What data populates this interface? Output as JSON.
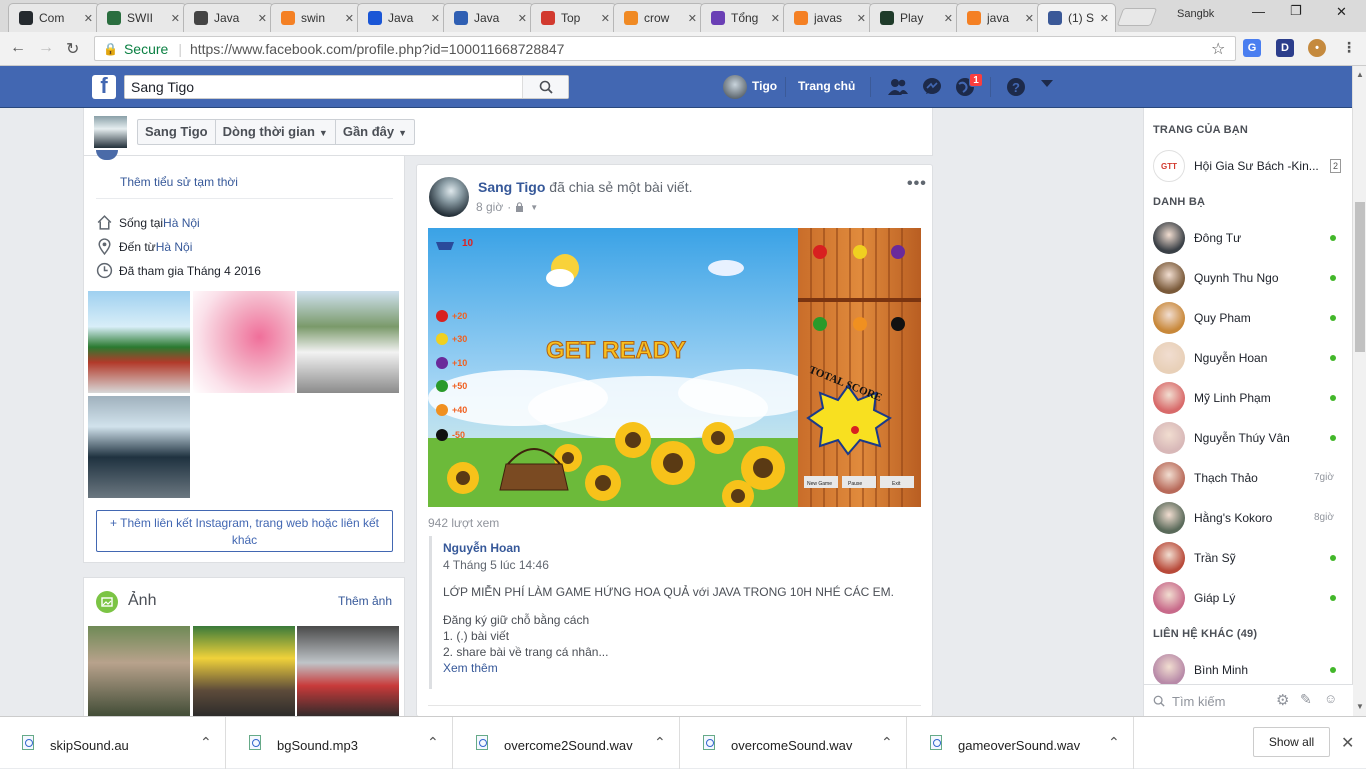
{
  "browser": {
    "tabs": [
      {
        "label": "Com",
        "icon": "github-icon",
        "color": "#24292e"
      },
      {
        "label": "SWII",
        "icon": "diamond-icon",
        "color": "#2a6e3f"
      },
      {
        "label": "Java",
        "icon": "T-icon",
        "color": "#444444"
      },
      {
        "label": "swin",
        "icon": "stackoverflow-icon",
        "color": "#f48024"
      },
      {
        "label": "Java",
        "icon": "d-icon",
        "color": "#1a56d6"
      },
      {
        "label": "Java",
        "icon": "A-icon",
        "color": "#2f5fb3"
      },
      {
        "label": "Top",
        "icon": "t-red-icon",
        "color": "#d23a2f"
      },
      {
        "label": "crow",
        "icon": "rss-icon",
        "color": "#f08a24"
      },
      {
        "label": "Tổng",
        "icon": "at-icon",
        "color": "#6a3fb5"
      },
      {
        "label": "javas",
        "icon": "stackoverflow-icon",
        "color": "#f48024"
      },
      {
        "label": "Play",
        "icon": "terminal-icon",
        "color": "#1f3b2a"
      },
      {
        "label": "java",
        "icon": "stackoverflow-icon",
        "color": "#f48024"
      },
      {
        "label": "(1) S",
        "icon": "facebook-icon",
        "color": "#3b5998"
      }
    ],
    "profile_name": "Sangbk",
    "secure_label": "Secure",
    "url": "https://www.facebook.com/profile.php?id=100011668728847"
  },
  "fb": {
    "search_value": "Sang Tigo",
    "user_name": "Tigo",
    "home_label": "Trang chủ",
    "notif_count": "1",
    "accent": "#4267b2"
  },
  "profile_header": {
    "name_btn": "Sang Tigo",
    "timeline_btn": "Dòng thời gian",
    "recent_btn": "Gần đây"
  },
  "intro": {
    "temp_story": "Thêm tiểu sử tạm thời",
    "lives_prefix": "Sống tại ",
    "lives_city": "Hà Nội",
    "from_prefix": "Đến từ ",
    "from_city": "Hà Nội",
    "joined": "Đã tham gia Tháng 4 2016",
    "insta_link": "+ Thêm liên kết Instagram, trang web hoặc liên kết khác"
  },
  "photos": {
    "title": "Ảnh",
    "more": "Thêm ảnh"
  },
  "post": {
    "author": "Sang Tigo",
    "action": " đã chia sẻ một bài viết.",
    "time": "8 giờ",
    "views": "942 lượt xem",
    "game": {
      "count": "10",
      "get_ready": "GET READY",
      "total_score": "TOTAL SCORE",
      "scores": [
        "+20",
        "+30",
        "+10",
        "+50",
        "+40",
        "-50"
      ],
      "buttons": [
        "New Game",
        "Pause",
        "Exit"
      ]
    },
    "shared": {
      "name": "Nguyễn Hoan",
      "date": "4 Tháng 5 lúc 14:46",
      "title": "LỚP MIỄN PHÍ LÀM GAME HỨNG HOA QUẢ với JAVA TRONG 10H NHÉ CÁC EM.",
      "line1": "Đăng ký giữ chỗ bằng cách",
      "line2": "1. (.) bài viết",
      "line3": "2. share bài về trang cá nhân...",
      "more": "Xem thêm"
    }
  },
  "sidebar": {
    "pages_header": "TRANG CỦA BẠN",
    "page_name": "Hội Gia Sư Bách -Kin...",
    "page_badge": "2",
    "contacts_header": "DANH BẠ",
    "contacts": [
      {
        "name": "Đông Tư",
        "status": "online"
      },
      {
        "name": "Quynh Thu Ngo",
        "status": "online"
      },
      {
        "name": "Quy Pham",
        "status": "online"
      },
      {
        "name": "Nguyễn Hoan",
        "status": "online"
      },
      {
        "name": "Mỹ Linh Phạm",
        "status": "online"
      },
      {
        "name": "Nguyễn Thúy Vân",
        "status": "online"
      },
      {
        "name": "Thạch Thảo",
        "status": "7giờ"
      },
      {
        "name": "Hằng's Kokoro",
        "status": "8giờ"
      },
      {
        "name": "Trần Sỹ",
        "status": "online"
      },
      {
        "name": "Giáp Lý",
        "status": "online"
      }
    ],
    "other_header": "LIÊN HỆ KHÁC (49)",
    "other_contacts": [
      {
        "name": "Bình Minh",
        "status": "online"
      }
    ],
    "search_placeholder": "Tìm kiếm"
  },
  "downloads": {
    "files": [
      "skipSound.au",
      "bgSound.mp3",
      "overcome2Sound.wav",
      "overcomeSound.wav",
      "gameoverSound.wav"
    ],
    "show_all": "Show all"
  }
}
